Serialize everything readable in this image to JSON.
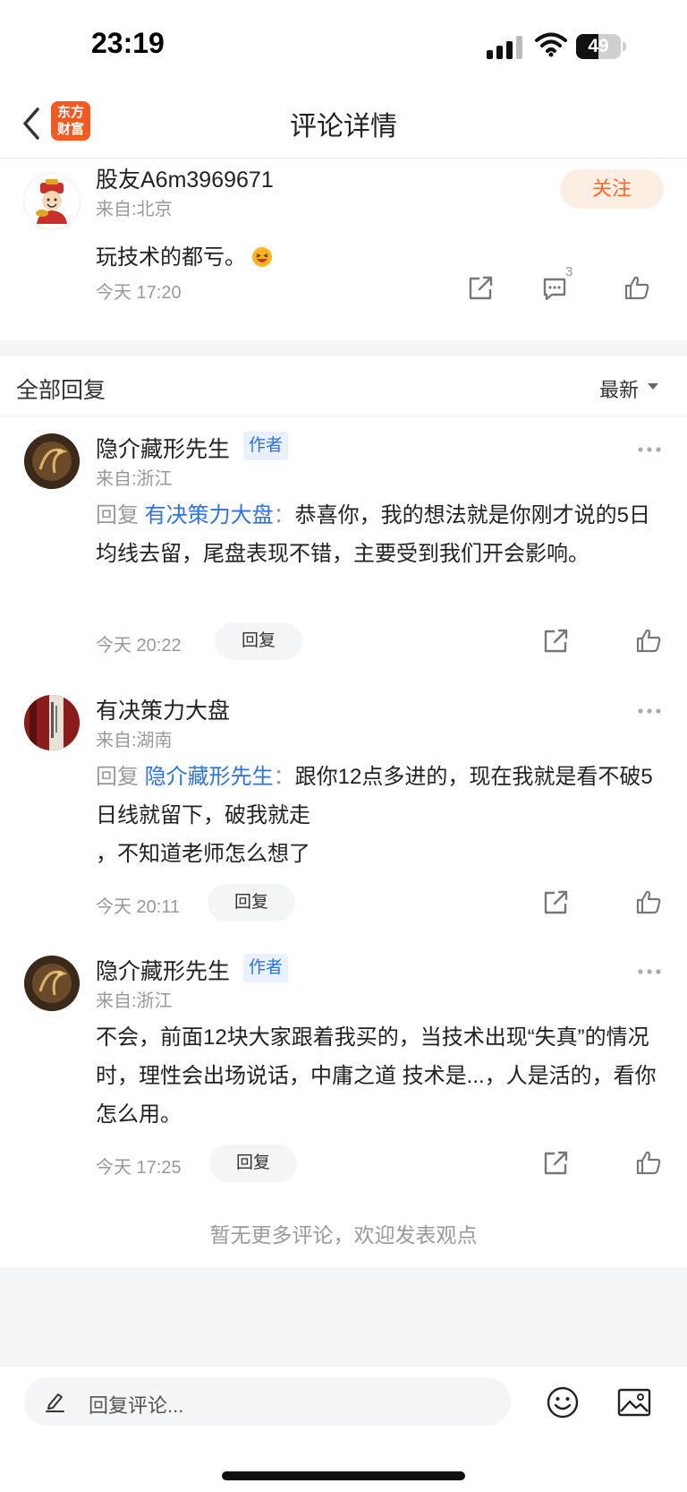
{
  "status_bar": {
    "time": "23:19",
    "battery": "49",
    "battery_level": 0.49
  },
  "header": {
    "title": "评论详情",
    "logo_line1": "东方",
    "logo_line2": "财富"
  },
  "main_comment": {
    "username": "股友A6m3969671",
    "location": "来自:北京",
    "follow_label": "关注",
    "text": "玩技术的都亏。",
    "time": "今天 17:20",
    "comment_count": "3"
  },
  "replies_header": {
    "title": "全部回复",
    "sort": "最新"
  },
  "replies": [
    {
      "username": "隐介藏形先生",
      "tag": "作者",
      "location": "来自:浙江",
      "prefix": "回复 ",
      "target": "有决策力大盘",
      "colon": "：",
      "text": "恭喜你，我的想法就是你刚才说的5日均线去留，尾盘表现不错，主要受到我们开会影响。",
      "time": "今天 20:22",
      "reply_label": "回复"
    },
    {
      "username": "有决策力大盘",
      "location": "来自:湖南",
      "prefix": "回复 ",
      "target": "隐介藏形先生",
      "colon": "：",
      "text": "跟你12点多进的，现在我就是看不破5日线就留下，破我就走",
      "text2": "，不知道老师怎么想了",
      "time": "今天 20:11",
      "reply_label": "回复"
    },
    {
      "username": "隐介藏形先生",
      "tag": "作者",
      "location": "来自:浙江",
      "text": "不会，前面12块大家跟着我买的，当技术出现“失真”的情况时，理性会出场说话，中庸之道 技术是...，人是活的，看你怎么用。",
      "time": "今天 17:25",
      "reply_label": "回复"
    }
  ],
  "footer": {
    "no_more": "暂无更多评论，欢迎发表观点"
  },
  "bottom_bar": {
    "placeholder": "回复评论..."
  },
  "colors": {
    "accent_orange": "#f26b2a",
    "link_blue": "#2f72d9",
    "logo_bg": "#f25a22"
  }
}
